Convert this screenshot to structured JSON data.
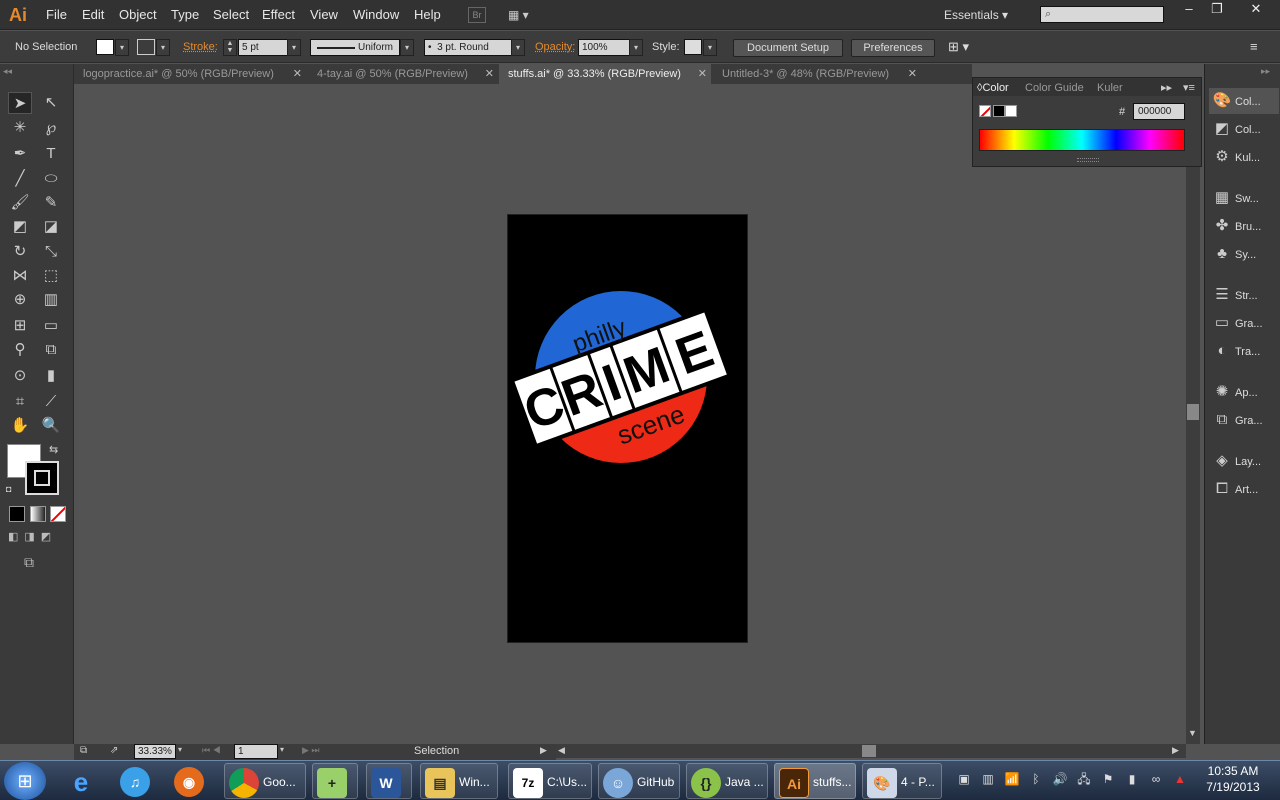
{
  "app": {
    "logo": "Ai"
  },
  "menu": [
    "File",
    "Edit",
    "Object",
    "Type",
    "Select",
    "Effect",
    "View",
    "Window",
    "Help"
  ],
  "bridge_label": "Br",
  "workspace": "Essentials",
  "search": {
    "placeholder": ""
  },
  "control": {
    "selection": "No Selection",
    "stroke_label": "Stroke:",
    "stroke_value": "5 pt",
    "profile": "Uniform",
    "brush": "3 pt. Round",
    "opacity_label": "Opacity:",
    "opacity_value": "100%",
    "style_label": "Style:",
    "document_setup": "Document Setup",
    "preferences": "Preferences"
  },
  "tabs": [
    {
      "label": "logopractice.ai* @ 50% (RGB/Preview)",
      "active": false
    },
    {
      "label": "4-tay.ai @ 50% (RGB/Preview)",
      "active": false
    },
    {
      "label": "stuffs.ai* @ 33.33% (RGB/Preview)",
      "active": true
    },
    {
      "label": "Untitled-3* @ 48% (RGB/Preview)",
      "active": false
    }
  ],
  "color_panel": {
    "tabs": [
      "Color",
      "Color Guide",
      "Kuler"
    ],
    "hex_label": "#",
    "hex_value": "000000"
  },
  "dock": [
    {
      "label": "Col...",
      "icon": "color-palette-icon"
    },
    {
      "label": "Col...",
      "icon": "color-guide-icon"
    },
    {
      "label": "Kul...",
      "icon": "kuler-icon"
    },
    {
      "label": "Sw...",
      "icon": "swatches-icon"
    },
    {
      "label": "Bru...",
      "icon": "brushes-icon"
    },
    {
      "label": "Sy...",
      "icon": "symbols-icon"
    },
    {
      "label": "Str...",
      "icon": "stroke-icon"
    },
    {
      "label": "Gra...",
      "icon": "gradient-icon"
    },
    {
      "label": "Tra...",
      "icon": "transparency-icon"
    },
    {
      "label": "Ap...",
      "icon": "appearance-icon"
    },
    {
      "label": "Gra...",
      "icon": "graphic-styles-icon"
    },
    {
      "label": "Lay...",
      "icon": "layers-icon"
    },
    {
      "label": "Art...",
      "icon": "artboards-icon"
    }
  ],
  "artwork": {
    "top_text": "philly",
    "main_text": [
      "C",
      "R",
      "I",
      "M",
      "E"
    ],
    "bottom_text": "scene",
    "colors": {
      "blue": "#2066d4",
      "red": "#ee2a16",
      "band": "#ffffff",
      "artboard": "#000000"
    }
  },
  "status": {
    "zoom": "33.33%",
    "artboard_num": "1",
    "tool_name": "Selection"
  },
  "taskbar": {
    "items": [
      {
        "label": "",
        "icon": "internet-explorer-icon"
      },
      {
        "label": "",
        "icon": "itunes-icon"
      },
      {
        "label": "",
        "icon": "firefox-icon"
      },
      {
        "label": "Goo...",
        "icon": "chrome-icon"
      },
      {
        "label": "",
        "icon": "notepad-plus-icon"
      },
      {
        "label": "",
        "icon": "word-icon"
      },
      {
        "label": "Win...",
        "icon": "explorer-icon"
      },
      {
        "label": "C:\\Us...",
        "icon": "7zip-icon"
      },
      {
        "label": "GitHub",
        "icon": "github-icon"
      },
      {
        "label": "Java ...",
        "icon": "java-icon"
      },
      {
        "label": "stuffs...",
        "icon": "illustrator-icon"
      },
      {
        "label": "4 - P...",
        "icon": "paint-icon"
      }
    ],
    "time": "10:35 AM",
    "date": "7/19/2013"
  }
}
